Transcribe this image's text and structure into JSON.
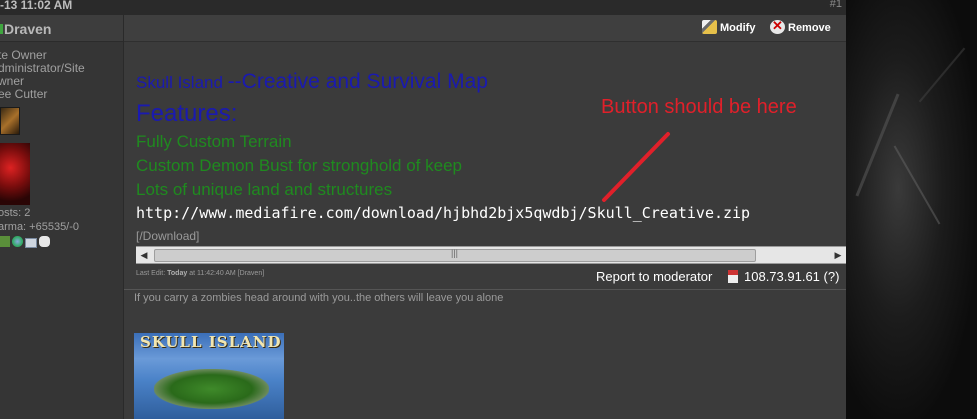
{
  "post_header": {
    "date": "-13  11:02 AM",
    "post_number": "#1"
  },
  "user": {
    "name": "Draven",
    "titles": [
      "te Owner",
      "dministrator/Site",
      "wner",
      "ee Cutter"
    ],
    "posts": "osts: 2",
    "karma": "arma: +65535/-0"
  },
  "toolbar": {
    "modify_label": "Modify",
    "remove_label": "Remove"
  },
  "post": {
    "title_prefix": "Skull Island ",
    "title_rest": "--Creative and Survival Map",
    "features_heading": "Features:",
    "feature_items": [
      "Fully Custom Terrain",
      "Custom Demon Bust for stronghold of keep",
      "Lots of unique land and structures"
    ],
    "code_text": "http://www.mediafire.com/download/hjbhd2bjx5qwdbj/Skull_Creative.zip",
    "download_tag": "[/Download]",
    "scrollbar_position": 0
  },
  "footer": {
    "last_edit_prefix": "Last Edit: ",
    "last_edit_day": "Today",
    "last_edit_rest": " at 11:42:40 AM [Draven]",
    "report_label": "Report to moderator",
    "ip_text": "108.73.91.61 (?)"
  },
  "signature": {
    "text": "If you carry a zombies head around with you..the others will leave you alone",
    "image_title": "SKULL ISLAND"
  },
  "annotation": {
    "text": "Button should be here",
    "color": "#e0202a"
  },
  "icons": [
    "edit-icon",
    "delete-icon",
    "online-icon",
    "rank-icon",
    "profile-icon",
    "msn-icon",
    "email-icon",
    "pm-icon",
    "scroll-left-icon",
    "scroll-right-icon",
    "ip-icon"
  ]
}
